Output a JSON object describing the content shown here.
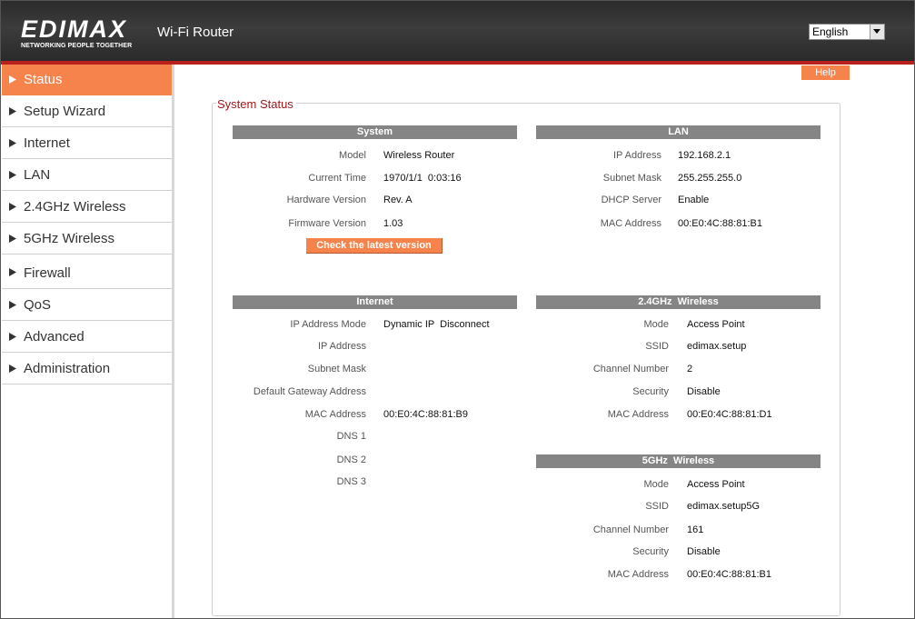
{
  "header": {
    "logo_main": "EDIMAX",
    "logo_sub": "NETWORKING PEOPLE TOGETHER",
    "title": "Wi-Fi Router",
    "language": "English"
  },
  "sidebar": {
    "items": [
      {
        "label": "Status"
      },
      {
        "label": "Setup Wizard"
      },
      {
        "label": "Internet"
      },
      {
        "label": "LAN"
      },
      {
        "label": "2.4GHz Wireless"
      },
      {
        "label": "5GHz Wireless"
      },
      {
        "label": "Firewall"
      },
      {
        "label": "QoS"
      },
      {
        "label": "Advanced"
      },
      {
        "label": "Administration"
      }
    ]
  },
  "help_label": "Help",
  "panel_title": "System Status",
  "system": {
    "title": "System",
    "rows": [
      {
        "label": "Model",
        "value": "Wireless Router"
      },
      {
        "label": "Current Time",
        "value": "1970/1/1  0:03:16"
      },
      {
        "label": "Hardware Version",
        "value": "Rev. A"
      },
      {
        "label": "Firmware Version",
        "value": "1.03"
      }
    ],
    "check_label": "Check the latest version"
  },
  "lan": {
    "title": "LAN",
    "rows": [
      {
        "label": "IP Address",
        "value": "192.168.2.1"
      },
      {
        "label": "Subnet Mask",
        "value": "255.255.255.0"
      },
      {
        "label": "DHCP Server",
        "value": "Enable"
      },
      {
        "label": "MAC Address",
        "value": "00:E0:4C:88:81:B1"
      }
    ]
  },
  "internet": {
    "title": "Internet",
    "rows": [
      {
        "label": "IP Address Mode",
        "value": "Dynamic IP  Disconnect"
      },
      {
        "label": "IP Address",
        "value": ""
      },
      {
        "label": "Subnet Mask",
        "value": ""
      },
      {
        "label": "Default Gateway Address",
        "value": ""
      },
      {
        "label": "MAC Address",
        "value": "00:E0:4C:88:81:B9"
      },
      {
        "label": "DNS 1",
        "value": ""
      },
      {
        "label": "DNS 2",
        "value": ""
      },
      {
        "label": "DNS 3",
        "value": ""
      }
    ]
  },
  "wireless24": {
    "title": "2.4GHz  Wireless",
    "rows": [
      {
        "label": "Mode",
        "value": "Access Point"
      },
      {
        "label": "SSID",
        "value": "edimax.setup"
      },
      {
        "label": "Channel Number",
        "value": "2"
      },
      {
        "label": "Security",
        "value": "Disable"
      },
      {
        "label": "MAC Address",
        "value": "00:E0:4C:88:81:D1"
      }
    ]
  },
  "wireless5": {
    "title": "5GHz  Wireless",
    "rows": [
      {
        "label": "Mode",
        "value": "Access Point"
      },
      {
        "label": "SSID",
        "value": "edimax.setup5G"
      },
      {
        "label": "Channel Number",
        "value": "161"
      },
      {
        "label": "Security",
        "value": "Disable"
      },
      {
        "label": "MAC Address",
        "value": "00:E0:4C:88:81:B1"
      }
    ]
  },
  "colors": {
    "accent": "#f5834b",
    "header_dark": "#333333",
    "header_red": "#b8211d",
    "section_gray": "#858585",
    "title_red": "#a01818"
  }
}
